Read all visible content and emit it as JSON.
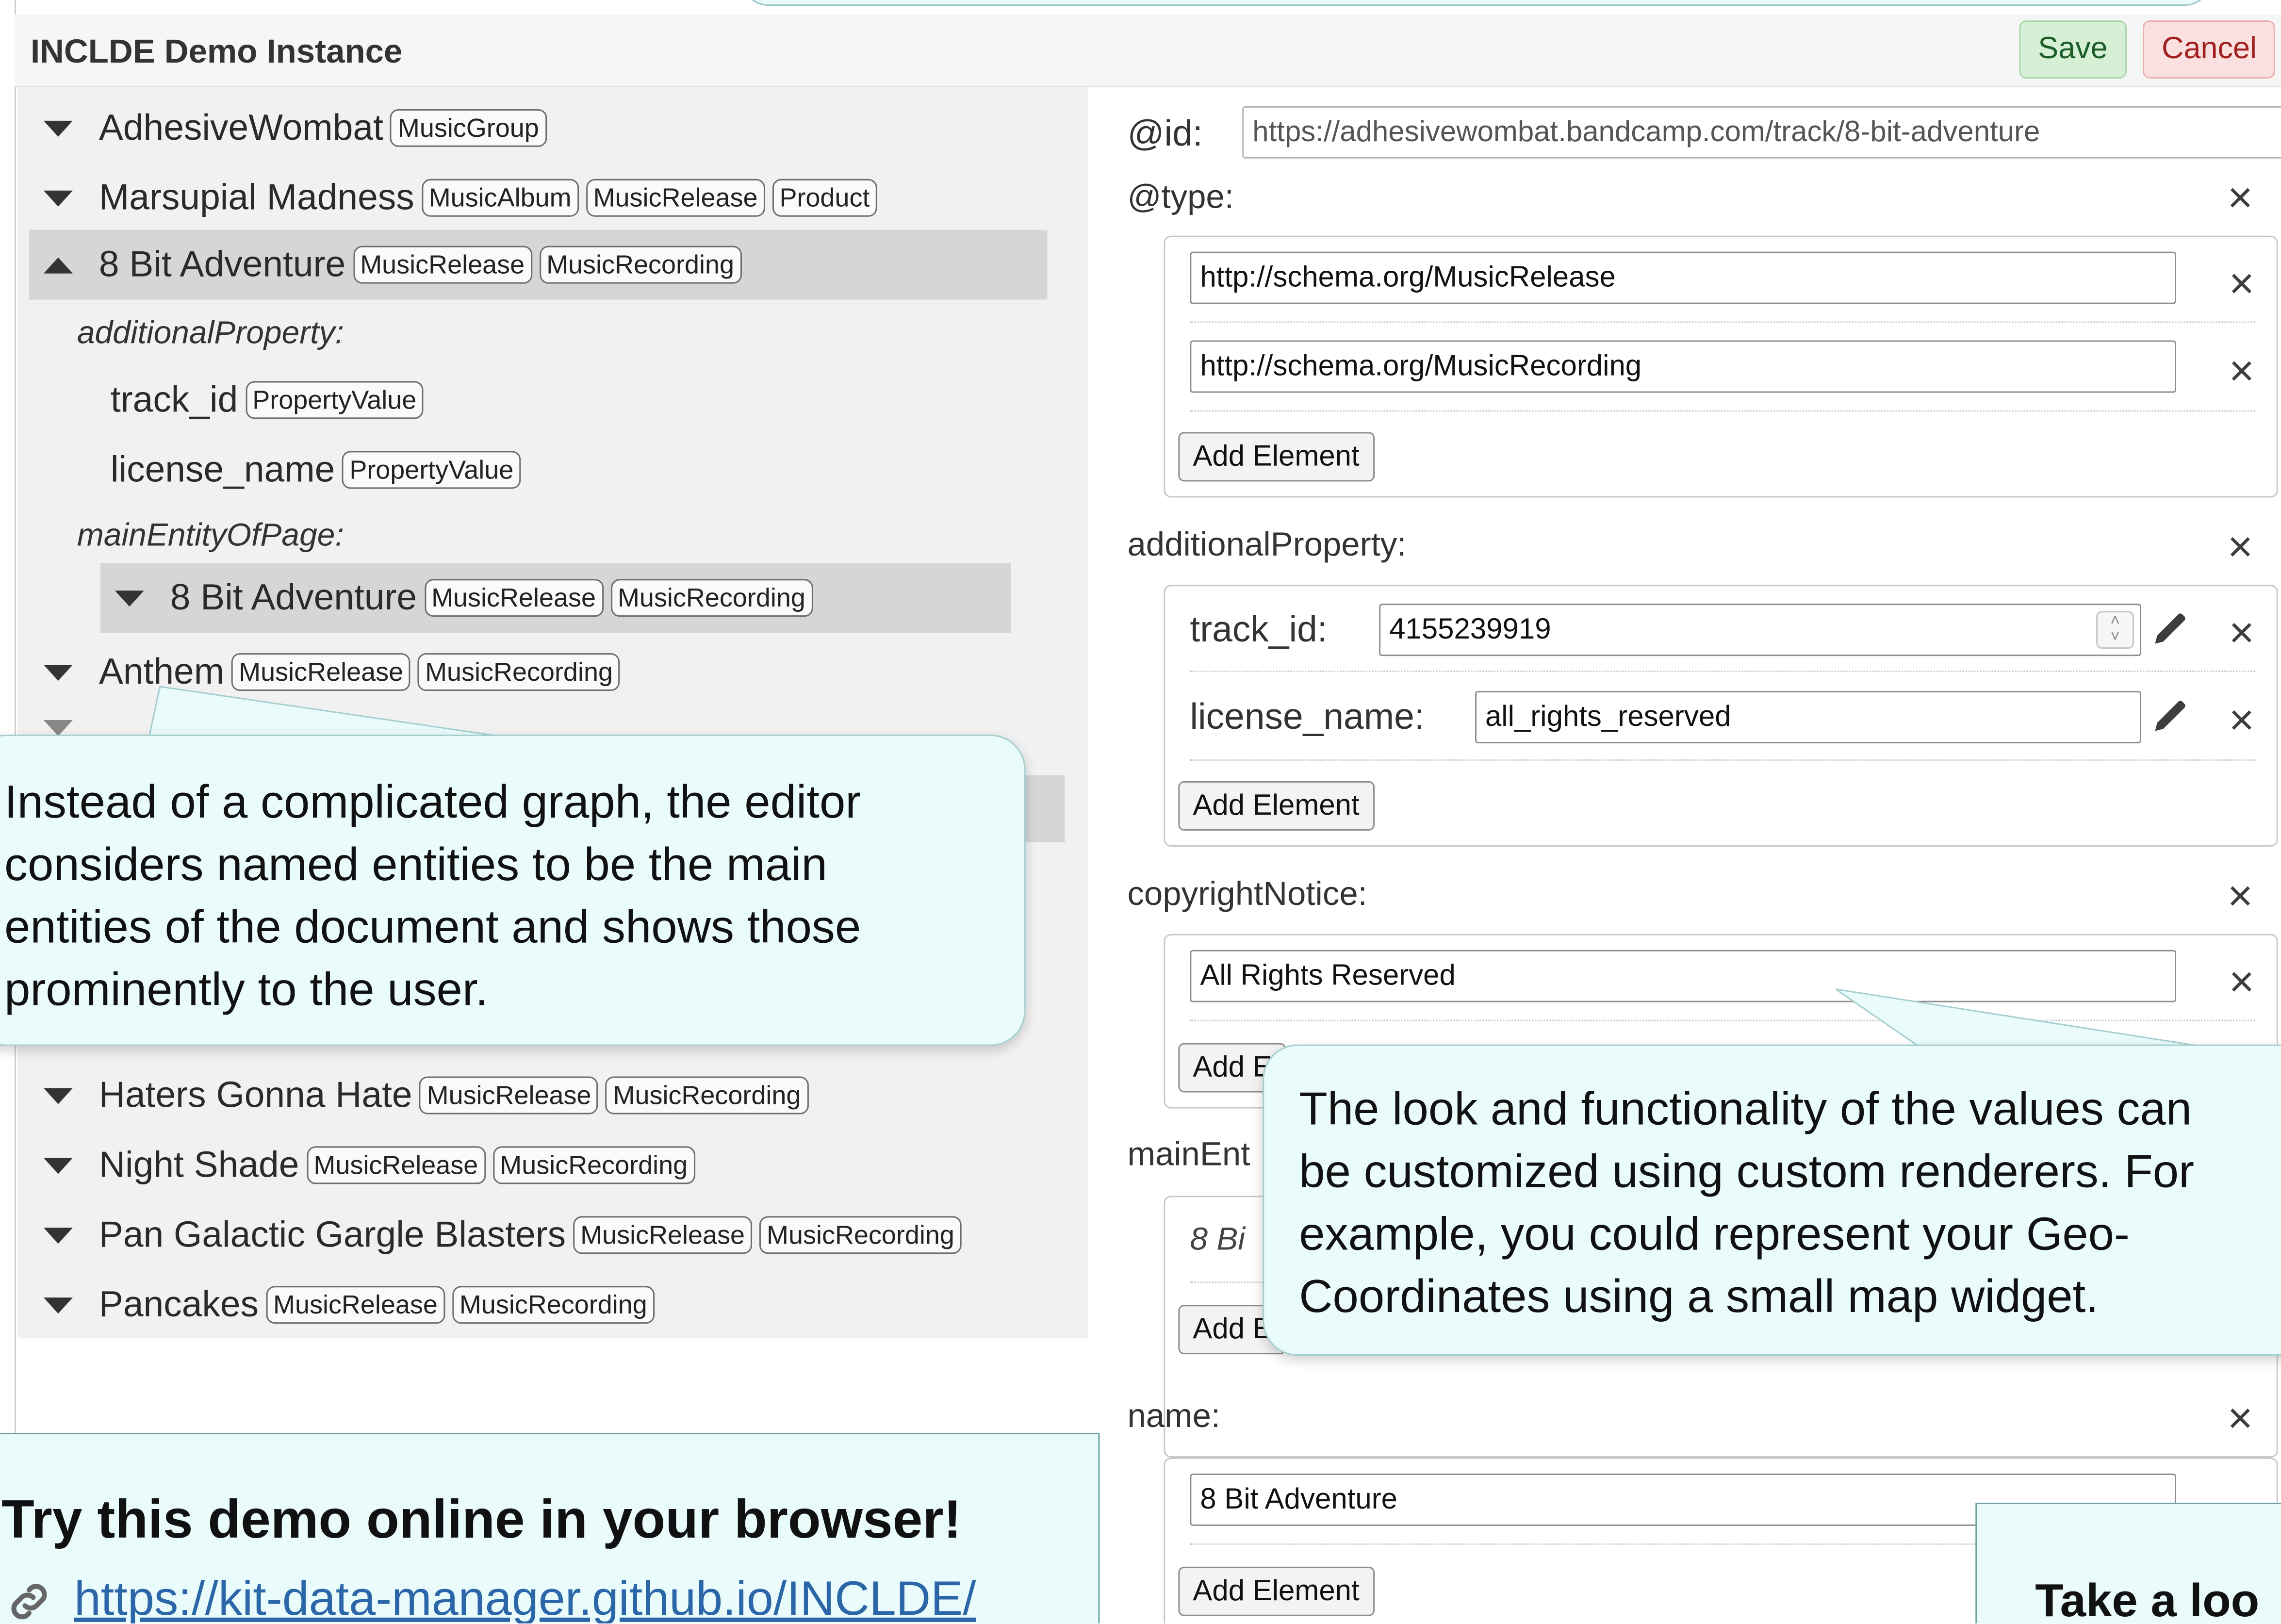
{
  "app": {
    "title": "INCLDE Demo Instance",
    "save_label": "Save",
    "cancel_label": "Cancel"
  },
  "tree": {
    "items": [
      {
        "label": "AdhesiveWombat",
        "badges": [
          "MusicGroup"
        ]
      },
      {
        "label": "Marsupial Madness",
        "badges": [
          "MusicAlbum",
          "MusicRelease",
          "Product"
        ]
      },
      {
        "label": "8 Bit Adventure",
        "badges": [
          "MusicRelease",
          "MusicRecording"
        ]
      },
      {
        "label": "Anthem",
        "badges": [
          "MusicRelease",
          "MusicRecording"
        ]
      },
      {
        "label": "Haters Gonna Hate",
        "badges": [
          "MusicRelease",
          "MusicRecording"
        ]
      },
      {
        "label": "Night Shade",
        "badges": [
          "MusicRelease",
          "MusicRecording"
        ]
      },
      {
        "label": "Pan Galactic Gargle Blasters",
        "badges": [
          "MusicRelease",
          "MusicRecording"
        ]
      },
      {
        "label": "Pancakes",
        "badges": [
          "MusicRelease",
          "MusicRecording"
        ]
      }
    ],
    "selected_children": {
      "additional_property_label": "additionalProperty:",
      "track_id": {
        "label": "track_id",
        "badge": "PropertyValue"
      },
      "license_name": {
        "label": "license_name",
        "badge": "PropertyValue"
      },
      "main_entity_label": "mainEntityOfPage:",
      "main_entity": {
        "label": "8 Bit Adventure",
        "badges": [
          "MusicRelease",
          "MusicRecording"
        ]
      }
    }
  },
  "editor": {
    "id_label": "@id:",
    "id_value": "https://adhesivewombat.bandcamp.com/track/8-bit-adventure",
    "type_label": "@type:",
    "type_values": [
      "http://schema.org/MusicRelease",
      "http://schema.org/MusicRecording"
    ],
    "add_element": "Add Element",
    "additional_property_label": "additionalProperty:",
    "track_id_label": "track_id:",
    "track_id_value": "4155239919",
    "license_name_label": "license_name:",
    "license_name_value": "all_rights_reserved",
    "copyright_label": "copyrightNotice:",
    "copyright_value": "All Rights Reserved",
    "main_entity_label": "mainEnt",
    "main_entity_value": "8 Bi",
    "name_label": "name:",
    "name_value": "8 Bit Adventure",
    "add_element_partial_1": "Add E",
    "add_element_partial_2": "Add E"
  },
  "callouts": {
    "left_lines": [
      "Instead of a complicated graph, the editor",
      "considers named entities to be the main",
      "entities of the document and shows those",
      "prominently to the user."
    ],
    "right_lines": [
      "The look and functionality of the values can",
      "be customized using custom renderers. For",
      "example, you could represent your Geo-",
      "Coordinates using a small map widget."
    ]
  },
  "promo": {
    "title": "Try this demo online in your browser!",
    "link": "https://kit-data-manager.github.io/INCLDE/",
    "title_2": "Take a loo"
  },
  "icons": [
    "triangle-down-icon",
    "triangle-up-icon",
    "close-icon",
    "pencil-icon",
    "spinner-icon",
    "link-icon"
  ],
  "colors": {
    "callout_bg": "#e9fbfb",
    "save_bg": "#d6f0d6",
    "cancel_bg": "#fbe0e0",
    "link": "#2a66a8"
  }
}
